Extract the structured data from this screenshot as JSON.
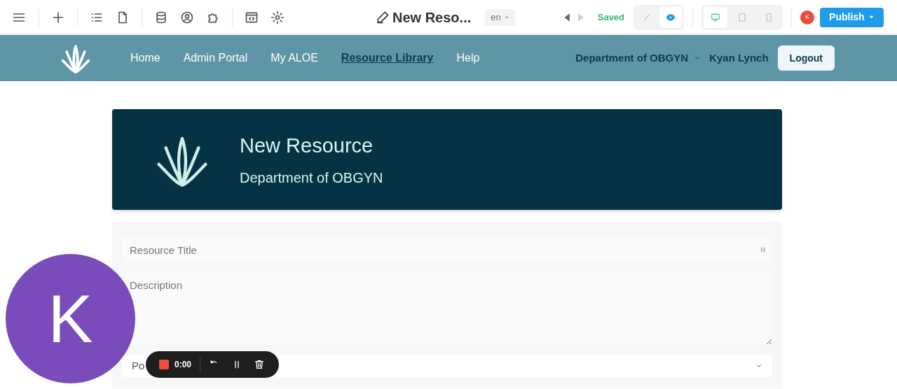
{
  "editor_bar": {
    "title": "New Reso...",
    "language": "en",
    "status": "Saved",
    "view_modes": [
      {
        "kind": "edit",
        "selected": false
      },
      {
        "kind": "preview",
        "selected": true
      }
    ],
    "devices": [
      {
        "kind": "desktop",
        "selected": true
      },
      {
        "kind": "tablet",
        "selected": false
      },
      {
        "kind": "phone",
        "selected": false
      }
    ],
    "user_initial": "K",
    "publish": "Publish"
  },
  "nav": {
    "items": [
      {
        "label": "Home",
        "selected": false
      },
      {
        "label": "Admin Portal",
        "selected": false
      },
      {
        "label": "My ALOE",
        "selected": false
      },
      {
        "label": "Resource Library",
        "selected": true
      },
      {
        "label": "Help",
        "selected": false
      }
    ],
    "department": "Department of OBGYN",
    "user": "Kyan Lynch",
    "logout": "Logout"
  },
  "banner": {
    "title": "New Resource",
    "subtitle": "Department of OBGYN"
  },
  "form": {
    "title_placeholder": "Resource Title",
    "description_placeholder": "Description",
    "select_value": "Po"
  },
  "avatar": {
    "initial": "K"
  },
  "recorder": {
    "time": "0:00"
  }
}
